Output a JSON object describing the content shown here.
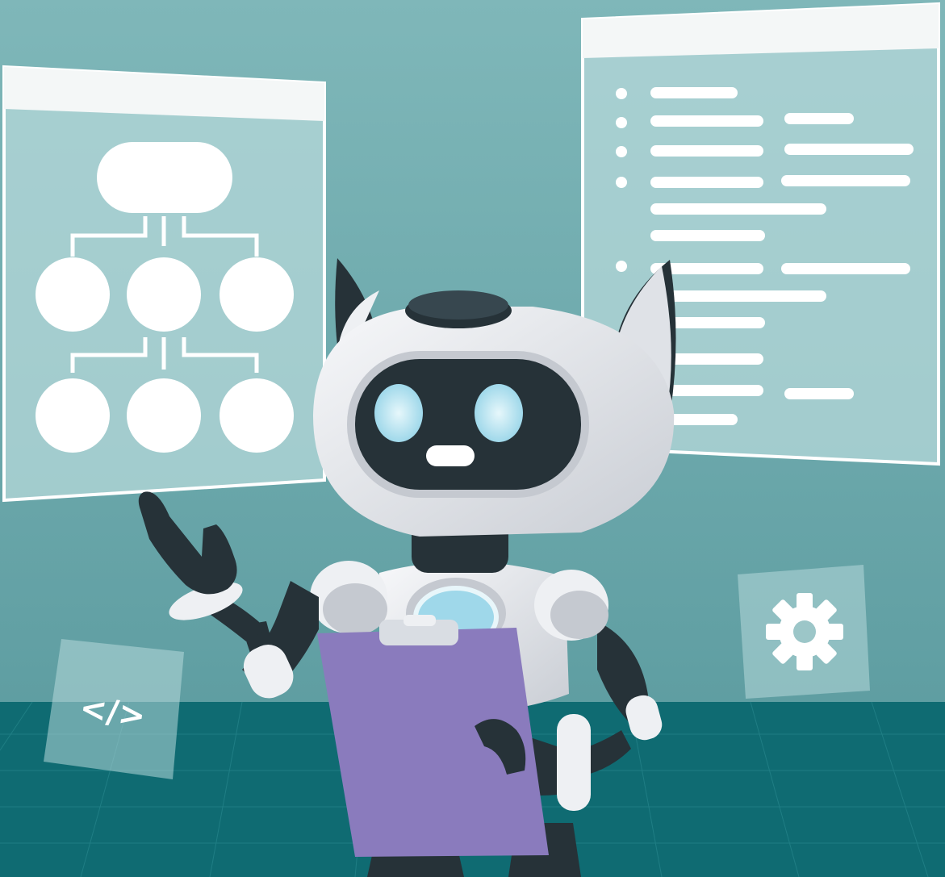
{
  "scene": {
    "colors": {
      "wall_top": "#7fb7b9",
      "wall_bottom": "#5f9ea2",
      "floor": "#0f6b72",
      "floor_line": "#2a8a90",
      "panel_fill": "#b6d8da",
      "panel_header": "#f4f7f7",
      "panel_border": "#ffffff",
      "robot_white": "#eef0f3",
      "robot_shade": "#c5c9d0",
      "robot_dark": "#263238",
      "eye_glow": "#bfe7f2",
      "clipboard": "#8a7bbd",
      "clipboard_clip": "#d9dde3"
    },
    "left_panel": {
      "kind": "flowchart-window"
    },
    "right_panel": {
      "kind": "bulleted-list-window",
      "bullets": 5
    },
    "code_tile": {
      "icon": "code-brackets-icon",
      "label": "</>"
    },
    "gear_tile": {
      "icon": "gear-icon"
    }
  }
}
